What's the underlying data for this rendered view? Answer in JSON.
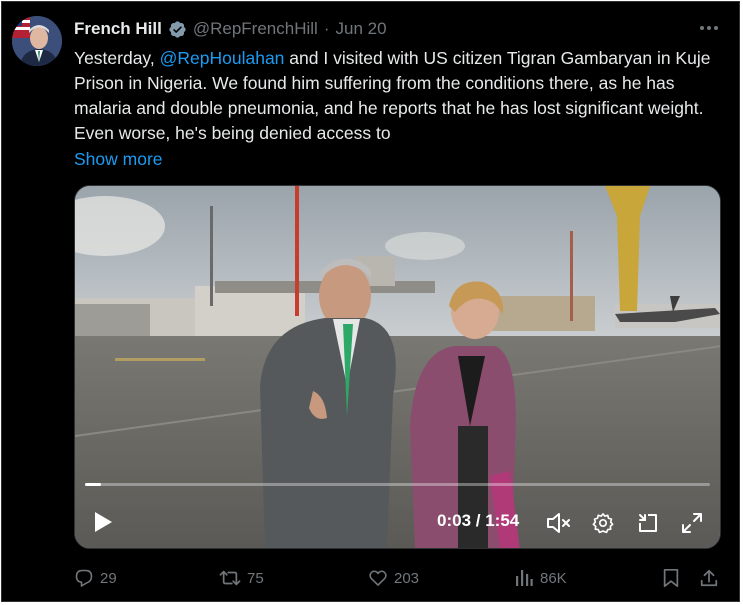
{
  "tweet": {
    "author_name": "French Hill",
    "handle": "@RepFrenchHill",
    "separator": "·",
    "date": "Jun 20",
    "text_before": "Yesterday, ",
    "mention": "@RepHoulahan",
    "text_after": " and I visited with US citizen Tigran Gambaryan in Kuje Prison in Nigeria. We found him suffering from the conditions there, as he has malaria and double pneumonia, and he reports that he has lost significant weight. Even worse, he's being denied access to",
    "show_more": "Show more"
  },
  "video": {
    "current_time": "0:03",
    "time_separator": " / ",
    "duration": "1:54",
    "progress_fraction": 0.026
  },
  "actions": {
    "replies": "29",
    "reposts": "75",
    "likes": "203",
    "views": "86K"
  },
  "colors": {
    "background": "#000000",
    "text": "#e7e9ea",
    "secondary": "#71767b",
    "accent": "#1d9bf0",
    "verified": "#829aab"
  },
  "icons": [
    "verified-badge-icon",
    "more-icon",
    "play-icon",
    "mute-icon",
    "settings-icon",
    "minimize-icon",
    "fullscreen-icon",
    "reply-icon",
    "repost-icon",
    "like-icon",
    "views-icon",
    "bookmark-icon",
    "share-icon"
  ]
}
